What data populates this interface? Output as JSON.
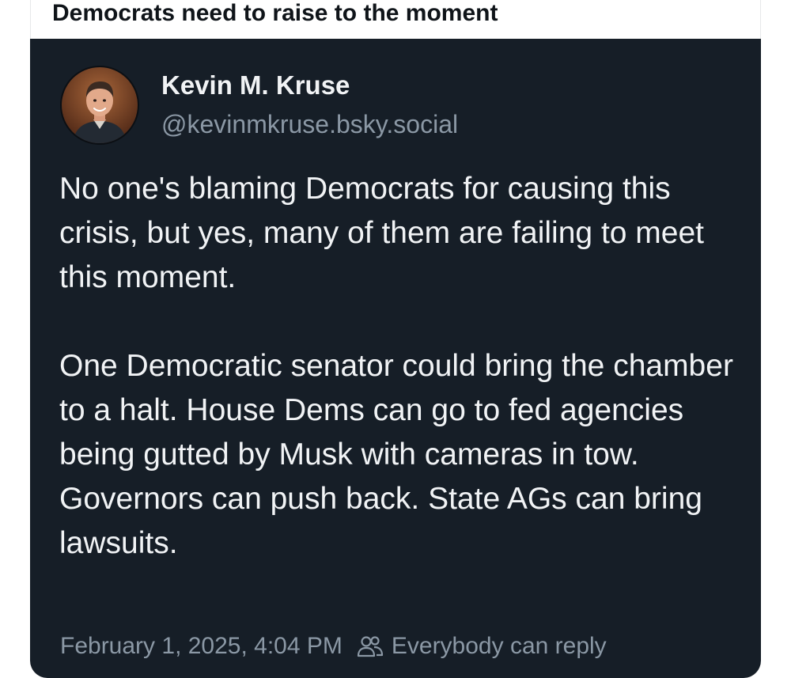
{
  "headline": "Democrats need to raise to the moment",
  "post": {
    "author_name": "Kevin M. Kruse",
    "author_handle": "@kevinmkruse.bsky.social",
    "avatar_icon": "author-avatar-photo",
    "paragraphs": [
      "No one's blaming Democrats for causing this crisis, but yes, many of them are failing to meet this moment.",
      "One Democratic senator could bring the chamber to a halt. House Dems can go to fed agencies being gutted by Musk with cameras in tow. Governors can push back. State AGs can bring lawsuits."
    ],
    "timestamp": "February 1, 2025, 4:04 PM",
    "reply_setting_icon": "people-icon",
    "reply_setting": "Everybody can reply"
  },
  "colors": {
    "card_background": "#161e27",
    "primary_text": "#f1f3f5",
    "secondary_text": "#8b98a5",
    "page_background": "#ffffff"
  }
}
